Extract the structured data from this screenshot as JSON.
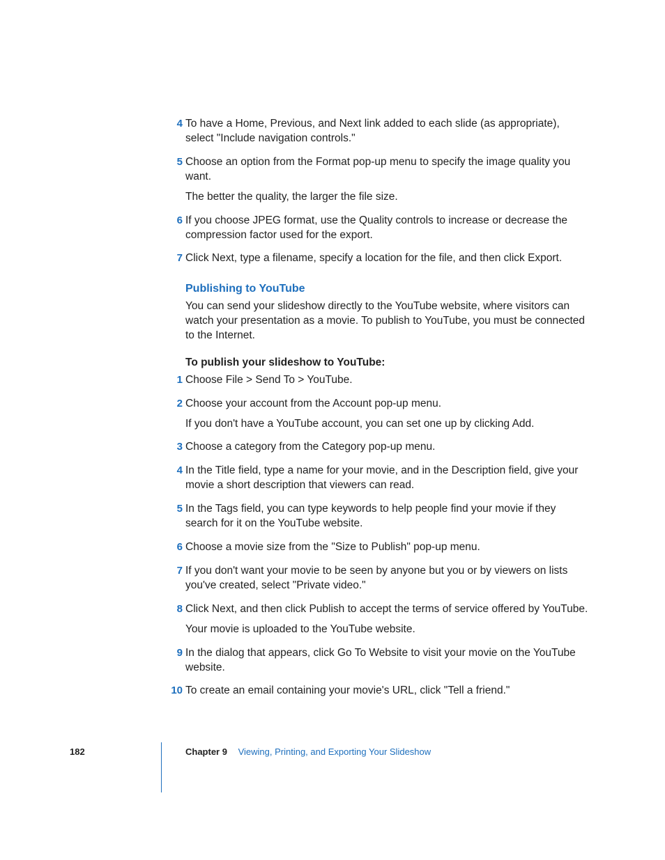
{
  "firstList": [
    {
      "num": "4",
      "paras": [
        "To have a Home, Previous, and Next link added to each slide (as appropriate), select \"Include navigation controls.\""
      ]
    },
    {
      "num": "5",
      "paras": [
        "Choose an option from the Format pop-up menu to specify the image quality you want.",
        "The better the quality, the larger the file size."
      ]
    },
    {
      "num": "6",
      "paras": [
        "If you choose JPEG format, use the Quality controls to increase or decrease the compression factor used for the export."
      ]
    },
    {
      "num": "7",
      "paras": [
        "Click Next, type a filename, specify a location for the file, and then click Export."
      ]
    }
  ],
  "section": {
    "heading": "Publishing to YouTube",
    "intro": "You can send your slideshow directly to the YouTube website, where visitors can watch your presentation as a movie. To publish to YouTube, you must be connected to the Internet.",
    "lead": "To publish your slideshow to YouTube:"
  },
  "secondList": [
    {
      "num": "1",
      "paras": [
        "Choose File > Send To > YouTube."
      ]
    },
    {
      "num": "2",
      "paras": [
        "Choose your account from the Account pop-up menu.",
        "If you don't have a YouTube account, you can set one up by clicking Add."
      ]
    },
    {
      "num": "3",
      "paras": [
        "Choose a category from the Category pop-up menu."
      ]
    },
    {
      "num": "4",
      "paras": [
        "In the Title field, type a name for your movie, and in the Description field, give your movie a short description that viewers can read."
      ]
    },
    {
      "num": "5",
      "paras": [
        "In the Tags field, you can type keywords to help people find your movie if they search for it on the YouTube website."
      ]
    },
    {
      "num": "6",
      "paras": [
        "Choose a movie size from the \"Size to Publish\" pop-up menu."
      ]
    },
    {
      "num": "7",
      "paras": [
        "If you don't want your movie to be seen by anyone but you or by viewers on lists you've created, select \"Private video.\""
      ]
    },
    {
      "num": "8",
      "paras": [
        "Click Next, and then click Publish to accept the terms of service offered by YouTube.",
        "Your movie is uploaded to the YouTube website."
      ]
    },
    {
      "num": "9",
      "paras": [
        "In the dialog that appears, click Go To Website to visit your movie on the YouTube website."
      ]
    },
    {
      "num": "10",
      "paras": [
        "To create an email containing your movie's URL, click \"Tell a friend.\""
      ]
    }
  ],
  "footer": {
    "page": "182",
    "chapterLabel": "Chapter 9",
    "chapterTitle": "Viewing, Printing, and Exporting Your Slideshow"
  }
}
